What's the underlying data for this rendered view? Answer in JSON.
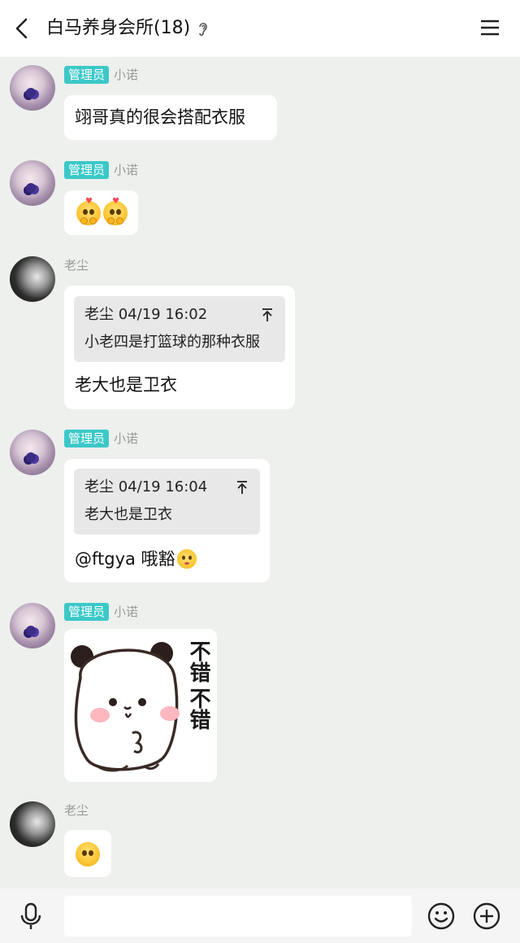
{
  "header": {
    "title": "白马养身会所(18)"
  },
  "messages": [
    {
      "sender": "小诺",
      "badge": "管理员",
      "text": "翊哥真的很会搭配衣服"
    },
    {
      "sender": "小诺",
      "badge": "管理员",
      "content": "two heart-eyes emojis"
    },
    {
      "sender": "老尘",
      "quote": {
        "author_time": "老尘 04/19 16:02",
        "text": "小老四是打篮球的那种衣服"
      },
      "text": "老大也是卫衣"
    },
    {
      "sender": "小诺",
      "badge": "管理员",
      "quote": {
        "author_time": "老尘 04/19 16:04",
        "text": "老大也是卫衣"
      },
      "text": "@ftgya 哦豁"
    },
    {
      "sender": "小诺",
      "badge": "管理员",
      "sticker": {
        "caption_line1": "不错",
        "caption_line2": "不错"
      }
    },
    {
      "sender": "老尘",
      "content": "single emoji"
    }
  ],
  "input": {
    "value": "",
    "placeholder": ""
  },
  "colors": {
    "badge": "#3cc8c8",
    "chat_bg": "#edf0ed",
    "bubble": "#ffffff",
    "quote_bg": "#e8e8e8"
  }
}
